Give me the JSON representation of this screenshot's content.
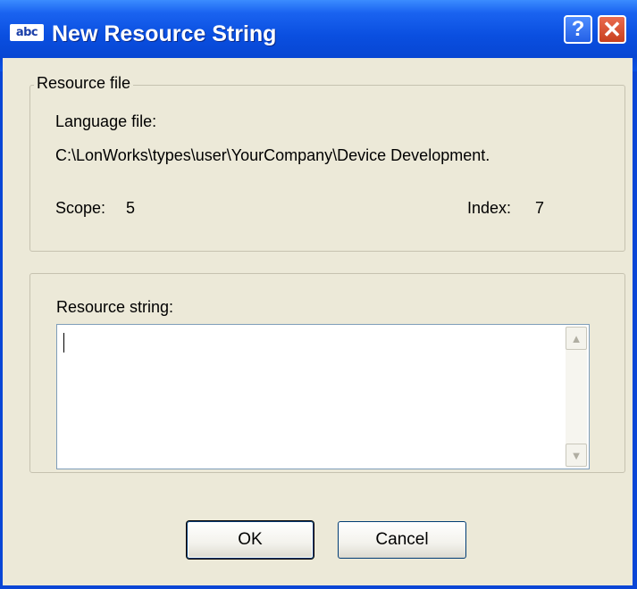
{
  "window": {
    "title": "New Resource String",
    "app_icon_text": "abc",
    "help_button": "?",
    "close_button": "✕"
  },
  "resource_file": {
    "legend": "Resource file",
    "language_file_label": "Language file:",
    "language_file_path": "C:\\LonWorks\\types\\user\\YourCompany\\Device Development.",
    "scope_label": "Scope:",
    "scope_value": "5",
    "index_label": "Index:",
    "index_value": "7"
  },
  "resource_string": {
    "label": "Resource string:",
    "value": ""
  },
  "buttons": {
    "ok": "OK",
    "cancel": "Cancel"
  },
  "colors": {
    "titlebar": "#0a4fe0",
    "dialog_background": "#ece9d8",
    "close_button": "#c8401e"
  }
}
